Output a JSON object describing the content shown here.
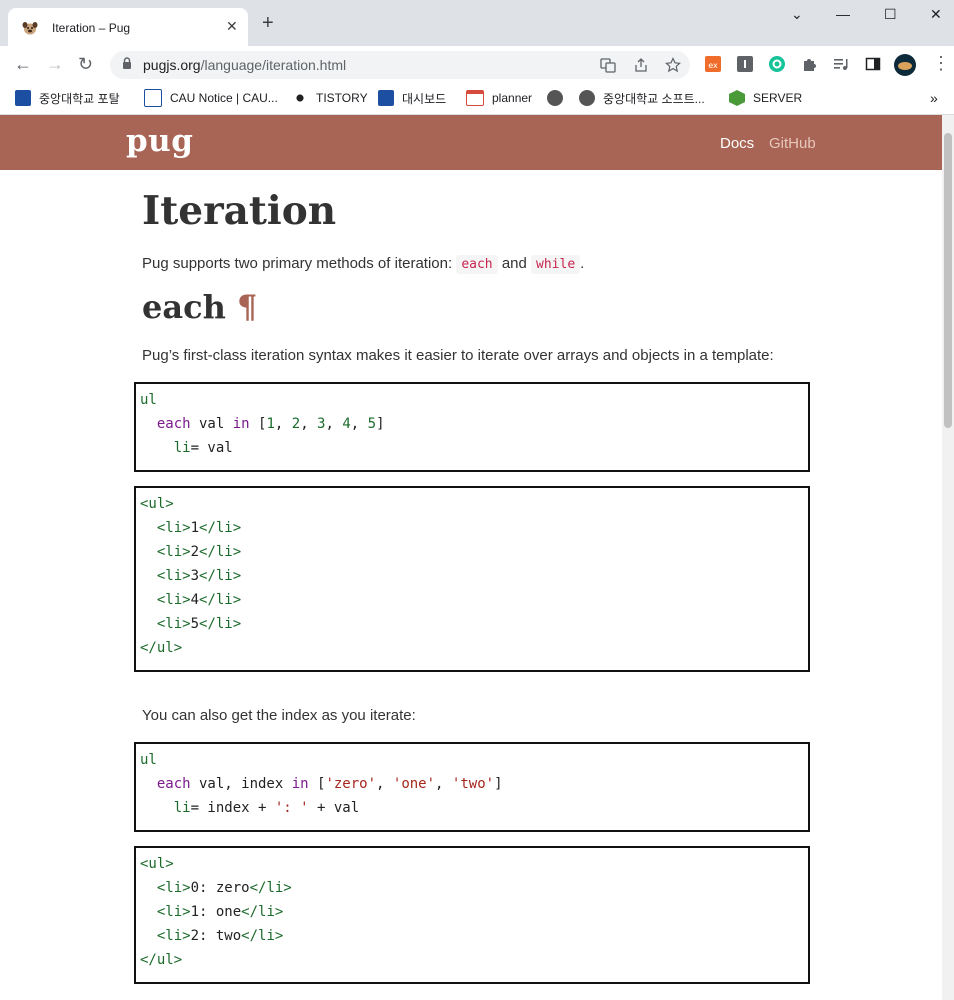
{
  "browser": {
    "tab_title": "Iteration – Pug",
    "url_host": "pugjs.org",
    "url_path": "/language/iteration.html",
    "bookmarks": [
      {
        "label": "중앙대학교 포탈",
        "icon_color": "#1c4ea1"
      },
      {
        "label": "CAU Notice | CAU...",
        "icon_color": "#1c4ea1"
      },
      {
        "label": "TISTORY",
        "icon_color": "#222222"
      },
      {
        "label": "대시보드",
        "icon_color": "#1c4ea1"
      },
      {
        "label": "planner",
        "icon_color": "#d64a3b"
      },
      {
        "label": "중앙대학교 소프트...",
        "icon_color": "#555555"
      },
      {
        "label": "SERVER",
        "icon_color": "#4a9a3a"
      }
    ]
  },
  "site": {
    "logo": "pug",
    "nav_docs": "Docs",
    "nav_github": "GitHub"
  },
  "page": {
    "title": "Iteration",
    "intro_prefix": "Pug supports two primary methods of iteration:",
    "intro_each": "each",
    "intro_and": "and",
    "intro_while": "while",
    "intro_suffix": ".",
    "section_title": "each",
    "pilcrow": "¶",
    "each_desc": "Pug’s first-class iteration syntax makes it easier to iterate over arrays and objects in a template:",
    "index_desc": "You can also get the index as you iterate:"
  },
  "colors": {
    "brand": "#a86454"
  }
}
